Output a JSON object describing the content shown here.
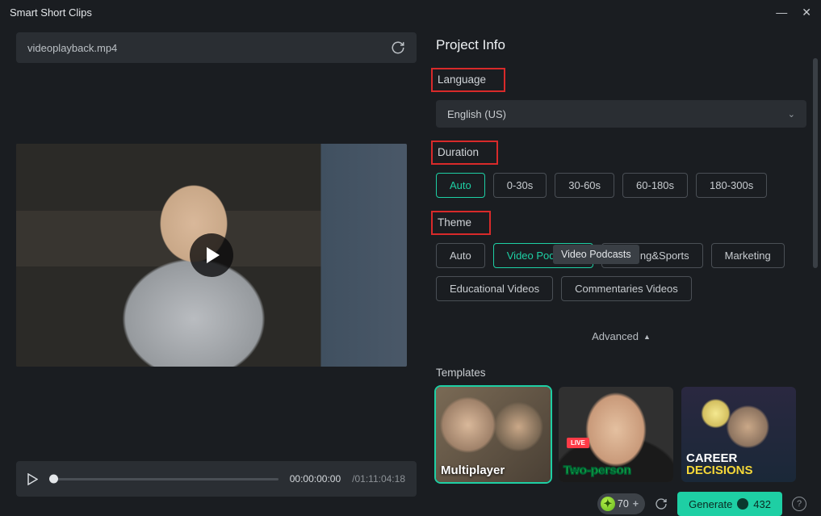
{
  "window": {
    "title": "Smart Short Clips"
  },
  "file": {
    "name": "videoplayback.mp4"
  },
  "timeline": {
    "current": "00:00:00:00",
    "total": "/01:11:04:18"
  },
  "project_info": {
    "header": "Project Info",
    "language": {
      "label": "Language",
      "value": "English (US)"
    },
    "duration": {
      "label": "Duration",
      "options": [
        "Auto",
        "0-30s",
        "30-60s",
        "60-180s",
        "180-300s"
      ],
      "active": 0
    },
    "theme": {
      "label": "Theme",
      "options": [
        "Auto",
        "Video Podcasts",
        "Gaming&Sports",
        "Marketing",
        "Educational Videos",
        "Commentaries Videos"
      ],
      "active": 1,
      "tooltip": "Video Podcasts"
    },
    "advanced": "Advanced"
  },
  "templates": {
    "label": "Templates",
    "items": [
      {
        "title": "Multiplayer"
      },
      {
        "title": "Two-person",
        "live": "LIVE"
      },
      {
        "title_a": "CAREER",
        "title_b": "DECISIONS"
      }
    ]
  },
  "footer": {
    "credits": "70",
    "generate_label": "Generate",
    "generate_cost": "432"
  }
}
